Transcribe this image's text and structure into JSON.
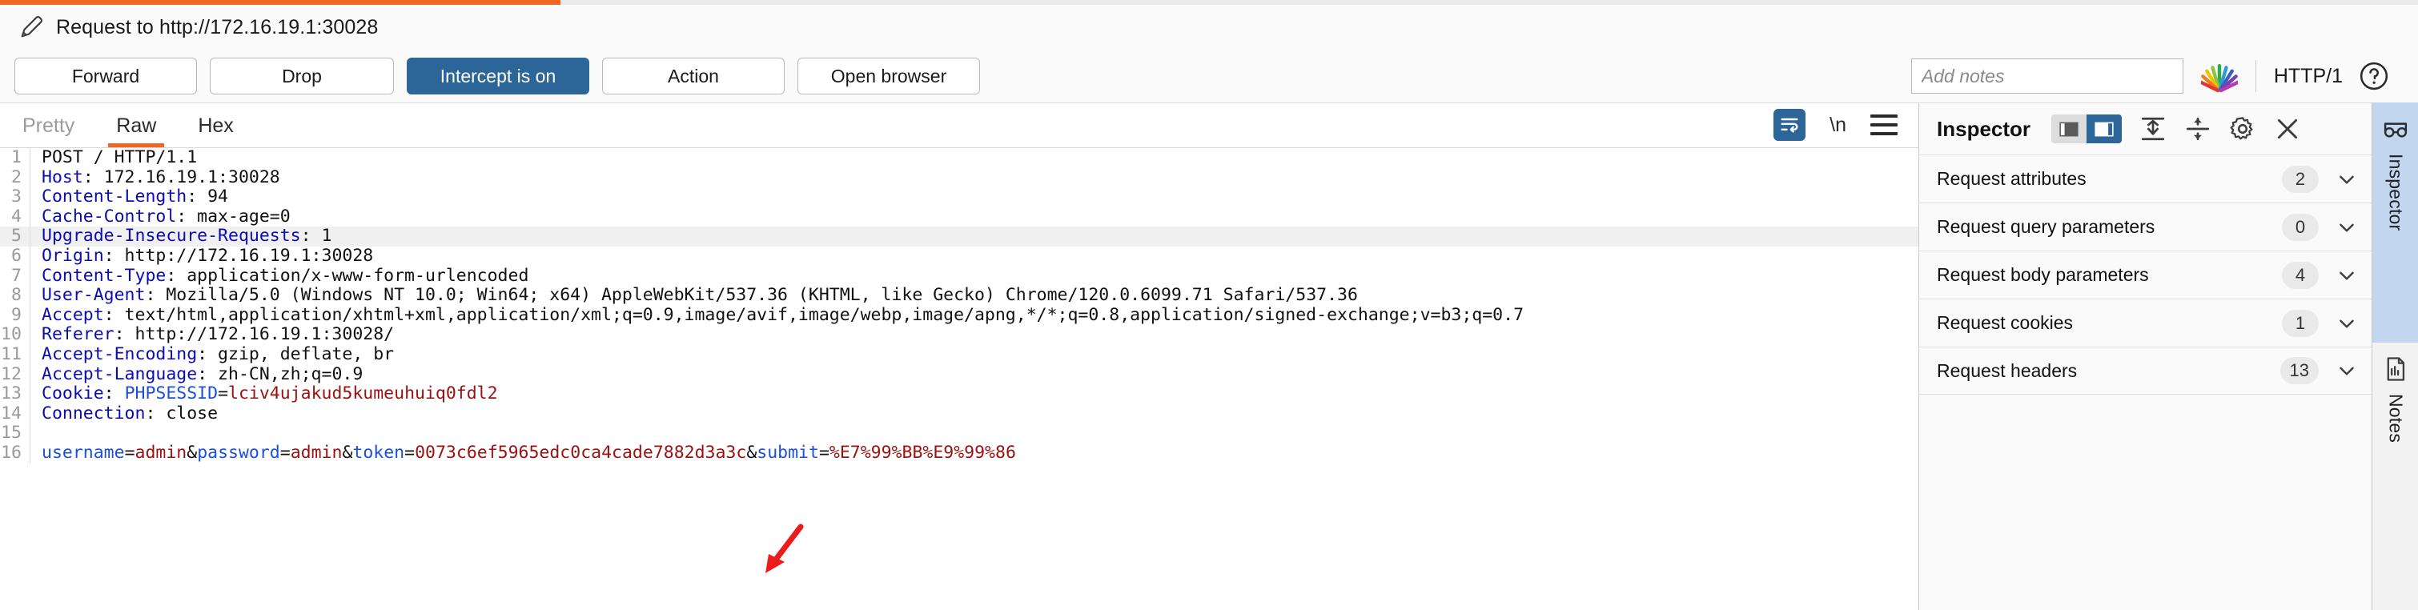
{
  "top_strip": {
    "accent_color": "#f26522"
  },
  "title_bar": {
    "icon": "pencil-icon",
    "text": "Request to http://172.16.19.1:30028"
  },
  "action_bar": {
    "buttons": [
      {
        "label": "Forward",
        "name": "forward-button",
        "active": false
      },
      {
        "label": "Drop",
        "name": "drop-button",
        "active": false
      },
      {
        "label": "Intercept is on",
        "name": "intercept-toggle",
        "active": true
      },
      {
        "label": "Action",
        "name": "action-button",
        "active": false
      },
      {
        "label": "Open browser",
        "name": "open-browser-button",
        "active": false
      }
    ],
    "notes_placeholder": "Add notes",
    "notes_value": "",
    "rainbow_icon": "burp-fan-icon",
    "http_version": "HTTP/1",
    "help_icon": "help-circle-icon",
    "active_color": "#2c6699"
  },
  "message_tabs": {
    "tabs": [
      {
        "label": "Pretty",
        "state": "inactive"
      },
      {
        "label": "Raw",
        "state": "active"
      },
      {
        "label": "Hex",
        "state": "normal"
      }
    ],
    "tools": [
      {
        "name": "word-wrap-icon",
        "label": "",
        "active": true
      },
      {
        "name": "newline-icon",
        "label": "\\n",
        "active": false
      },
      {
        "name": "hamburger-menu-icon",
        "label": "",
        "active": false
      }
    ]
  },
  "request": {
    "lines": [
      {
        "n": "1",
        "highlight": false,
        "parts": [
          {
            "t": "POST / HTTP/1.1",
            "c": "plain"
          }
        ]
      },
      {
        "n": "2",
        "highlight": false,
        "parts": [
          {
            "t": "Host",
            "c": "hdr"
          },
          {
            "t": ": 172.16.19.1:30028",
            "c": "plain"
          }
        ]
      },
      {
        "n": "3",
        "highlight": false,
        "parts": [
          {
            "t": "Content-Length",
            "c": "hdr"
          },
          {
            "t": ": 94",
            "c": "plain"
          }
        ]
      },
      {
        "n": "4",
        "highlight": false,
        "parts": [
          {
            "t": "Cache-Control",
            "c": "hdr"
          },
          {
            "t": ": max-age=0",
            "c": "plain"
          }
        ]
      },
      {
        "n": "5",
        "highlight": true,
        "parts": [
          {
            "t": "Upgrade-Insecure-Requests",
            "c": "hdr"
          },
          {
            "t": ": 1",
            "c": "plain"
          }
        ]
      },
      {
        "n": "6",
        "highlight": false,
        "parts": [
          {
            "t": "Origin",
            "c": "hdr"
          },
          {
            "t": ": http://172.16.19.1:30028",
            "c": "plain"
          }
        ]
      },
      {
        "n": "7",
        "highlight": false,
        "parts": [
          {
            "t": "Content-Type",
            "c": "hdr"
          },
          {
            "t": ": application/x-www-form-urlencoded",
            "c": "plain"
          }
        ]
      },
      {
        "n": "8",
        "highlight": false,
        "parts": [
          {
            "t": "User-Agent",
            "c": "hdr"
          },
          {
            "t": ": Mozilla/5.0 (Windows NT 10.0; Win64; x64) AppleWebKit/537.36 (KHTML, like Gecko) Chrome/120.0.6099.71 Safari/537.36",
            "c": "plain"
          }
        ]
      },
      {
        "n": "9",
        "highlight": false,
        "parts": [
          {
            "t": "Accept",
            "c": "hdr"
          },
          {
            "t": ": text/html,application/xhtml+xml,application/xml;q=0.9,image/avif,image/webp,image/apng,*/*;q=0.8,application/signed-exchange;v=b3;q=0.7",
            "c": "plain"
          }
        ]
      },
      {
        "n": "10",
        "highlight": false,
        "parts": [
          {
            "t": "Referer",
            "c": "hdr"
          },
          {
            "t": ": http://172.16.19.1:30028/",
            "c": "plain"
          }
        ]
      },
      {
        "n": "11",
        "highlight": false,
        "parts": [
          {
            "t": "Accept-Encoding",
            "c": "hdr"
          },
          {
            "t": ": gzip, deflate, br",
            "c": "plain"
          }
        ]
      },
      {
        "n": "12",
        "highlight": false,
        "parts": [
          {
            "t": "Accept-Language",
            "c": "hdr"
          },
          {
            "t": ": zh-CN,zh;q=0.9",
            "c": "plain"
          }
        ]
      },
      {
        "n": "13",
        "highlight": false,
        "parts": [
          {
            "t": "Cookie",
            "c": "hdr"
          },
          {
            "t": ": ",
            "c": "plain"
          },
          {
            "t": "PHPSESSID",
            "c": "name"
          },
          {
            "t": "=",
            "c": "plain"
          },
          {
            "t": "lciv4ujakud5kumeuhuiq0fdl2",
            "c": "val"
          }
        ]
      },
      {
        "n": "14",
        "highlight": false,
        "parts": [
          {
            "t": "Connection",
            "c": "hdr"
          },
          {
            "t": ": close",
            "c": "plain"
          }
        ]
      },
      {
        "n": "15",
        "highlight": false,
        "parts": [
          {
            "t": "",
            "c": "plain"
          }
        ]
      },
      {
        "n": "16",
        "highlight": false,
        "parts": [
          {
            "t": "username",
            "c": "name"
          },
          {
            "t": "=",
            "c": "plain"
          },
          {
            "t": "admin",
            "c": "val"
          },
          {
            "t": "&",
            "c": "plain"
          },
          {
            "t": "password",
            "c": "name"
          },
          {
            "t": "=",
            "c": "plain"
          },
          {
            "t": "admin",
            "c": "val"
          },
          {
            "t": "&",
            "c": "plain"
          },
          {
            "t": "token",
            "c": "name"
          },
          {
            "t": "=",
            "c": "plain"
          },
          {
            "t": "0073c6ef5965edc0ca4cade7882d3a3c",
            "c": "val"
          },
          {
            "t": "&",
            "c": "plain"
          },
          {
            "t": "submit",
            "c": "name"
          },
          {
            "t": "=",
            "c": "plain"
          },
          {
            "t": "%E7%99%BB%E9%99%86",
            "c": "val"
          }
        ]
      }
    ]
  },
  "annotation": {
    "name": "red-arrow-annotation",
    "color": "#ee1b1b"
  },
  "inspector": {
    "title": "Inspector",
    "header_icons": [
      {
        "name": "layout-left-icon",
        "active": false
      },
      {
        "name": "layout-right-icon",
        "active": true
      },
      {
        "name": "collapse-all-icon",
        "active": false
      },
      {
        "name": "expand-all-icon",
        "active": false
      },
      {
        "name": "gear-icon",
        "active": false
      },
      {
        "name": "close-icon",
        "active": false
      }
    ],
    "rows": [
      {
        "label": "Request attributes",
        "count": "2"
      },
      {
        "label": "Request query parameters",
        "count": "0"
      },
      {
        "label": "Request body parameters",
        "count": "4"
      },
      {
        "label": "Request cookies",
        "count": "1"
      },
      {
        "label": "Request headers",
        "count": "13"
      }
    ]
  },
  "right_rail": {
    "tabs": [
      {
        "label": "Inspector",
        "icon": "glasses-icon",
        "active": true
      },
      {
        "label": "Notes",
        "icon": "document-icon",
        "active": false
      }
    ]
  }
}
